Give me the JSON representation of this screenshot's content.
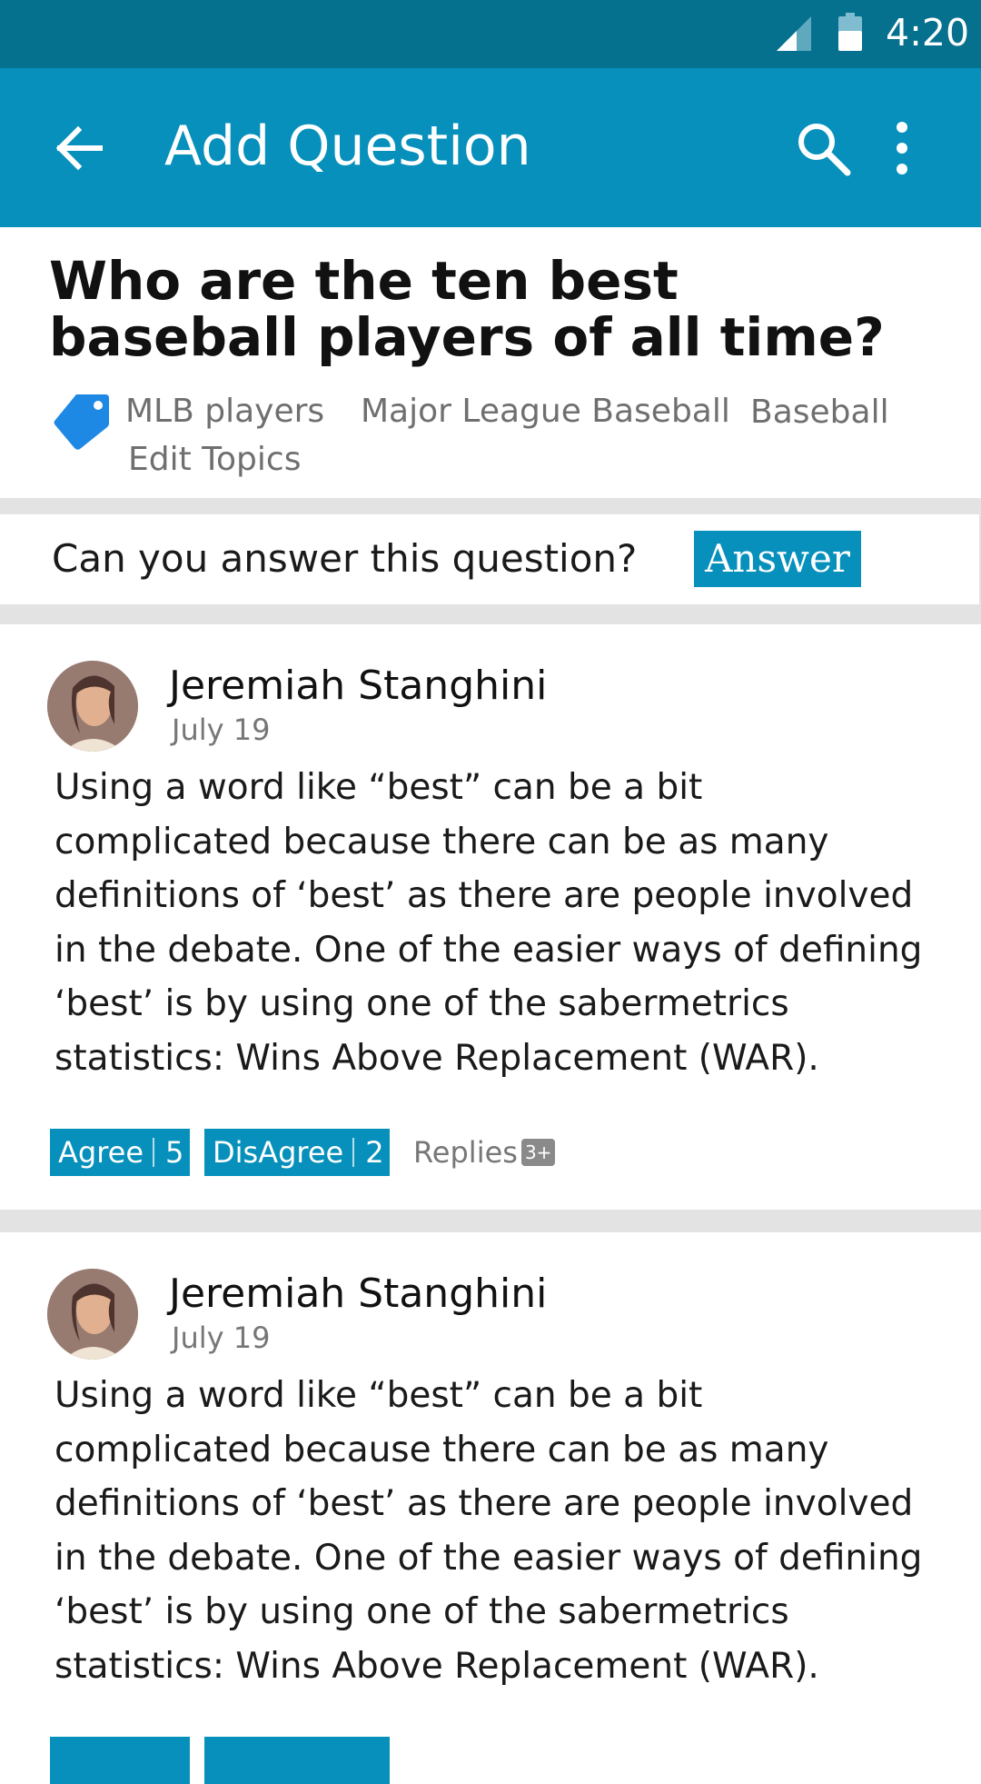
{
  "status_bar": {
    "time": "4:20",
    "icons": [
      "signal-icon",
      "battery-icon"
    ]
  },
  "app_bar": {
    "title": "Add Question",
    "icons": [
      "back-arrow-icon",
      "search-icon",
      "more-vert-icon"
    ]
  },
  "question": {
    "title": "Who are the ten best baseball players of all time?",
    "topics": [
      "MLB players",
      "Major League Baseball",
      "Baseball"
    ],
    "edit_topics_label": "Edit Topics"
  },
  "answer_prompt": {
    "text": "Can you answer this question?",
    "button_label": "Answer"
  },
  "answers": [
    {
      "author": "Jeremiah Stanghini",
      "date": "July 19",
      "body": "Using a word like “best” can be a bit complicated because there can be as many definitions of ‘best’ as there are people involved in the debate. One of the easier ways of defining ‘best’ is by using one of the sabermetrics statistics: Wins Above Replacement (WAR).",
      "agree_label": "Agree",
      "agree_count": "5",
      "disagree_label": "DisAgree",
      "disagree_count": "2",
      "replies_label": "Replies",
      "replies_badge": "3+"
    },
    {
      "author": "Jeremiah Stanghini",
      "date": "July 19",
      "body": "Using a word like “best” can be a bit complicated because there can be as many definitions of ‘best’ as there are people involved in the debate. One of the easier ways of defining ‘best’ is by using one of the sabermetrics statistics: Wins Above Replacement (WAR)."
    }
  ],
  "colors": {
    "status_bar": "#06708f",
    "app_bar": "#0690bb",
    "accent": "#0690bb",
    "tag_icon": "#1e88e5",
    "divider": "#e3e3e3"
  }
}
